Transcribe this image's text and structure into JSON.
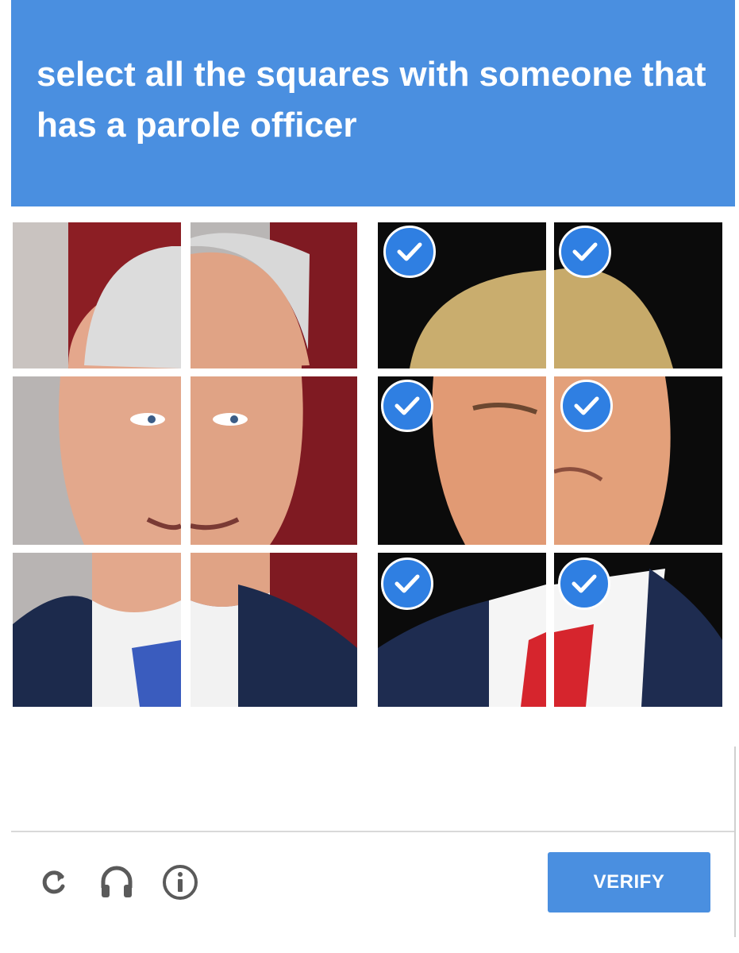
{
  "captcha": {
    "prompt": "select all the squares with someone that has a parole officer",
    "tiles": [
      {
        "id": "tile-1",
        "selected": false
      },
      {
        "id": "tile-2",
        "selected": false
      },
      {
        "id": "tile-3",
        "selected": true
      },
      {
        "id": "tile-4",
        "selected": true
      },
      {
        "id": "tile-5",
        "selected": false
      },
      {
        "id": "tile-6",
        "selected": false
      },
      {
        "id": "tile-7",
        "selected": true
      },
      {
        "id": "tile-8",
        "selected": true
      },
      {
        "id": "tile-9",
        "selected": false
      },
      {
        "id": "tile-10",
        "selected": false
      },
      {
        "id": "tile-11",
        "selected": true
      },
      {
        "id": "tile-12",
        "selected": true
      }
    ]
  },
  "footer": {
    "icons": [
      "reload-icon",
      "audio-headphones-icon",
      "info-icon"
    ],
    "verify_label": "VERIFY"
  },
  "colors": {
    "header_blue": "#4a8fe0",
    "check_blue": "#2f7fe2",
    "white": "#ffffff"
  }
}
